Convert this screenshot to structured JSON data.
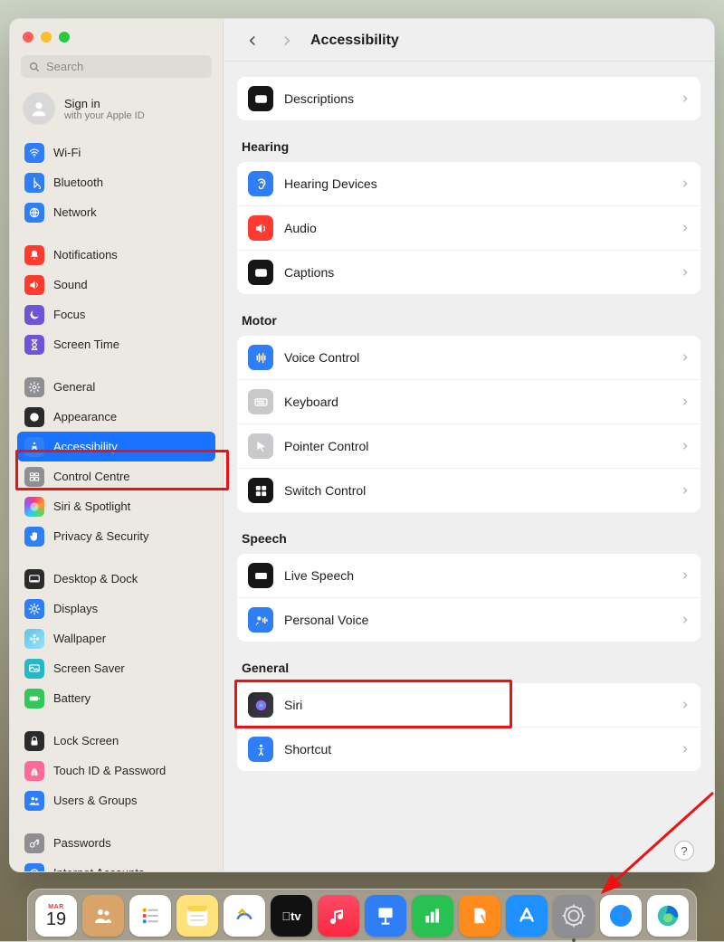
{
  "window": {
    "title": "Accessibility"
  },
  "search": {
    "placeholder": "Search"
  },
  "account": {
    "title": "Sign in",
    "subtitle": "with your Apple ID"
  },
  "sidebar": {
    "items": [
      {
        "label": "Wi-Fi",
        "iconClass": "bg-blue",
        "glyph": "wifi"
      },
      {
        "label": "Bluetooth",
        "iconClass": "bg-blue",
        "glyph": "bt"
      },
      {
        "label": "Network",
        "iconClass": "bg-blue",
        "glyph": "globe"
      },
      {
        "label": "Notifications",
        "iconClass": "bg-red",
        "glyph": "bell"
      },
      {
        "label": "Sound",
        "iconClass": "bg-red",
        "glyph": "speaker"
      },
      {
        "label": "Focus",
        "iconClass": "bg-purple",
        "glyph": "moon"
      },
      {
        "label": "Screen Time",
        "iconClass": "bg-purple",
        "glyph": "hourglass"
      },
      {
        "label": "General",
        "iconClass": "bg-gray",
        "glyph": "gear"
      },
      {
        "label": "Appearance",
        "iconClass": "bg-dark",
        "glyph": "appearance"
      },
      {
        "label": "Accessibility",
        "iconClass": "bg-blue",
        "glyph": "access",
        "selected": true
      },
      {
        "label": "Control Centre",
        "iconClass": "bg-gray",
        "glyph": "cc"
      },
      {
        "label": "Siri & Spotlight",
        "iconClass": "bg-spot",
        "glyph": "siri"
      },
      {
        "label": "Privacy & Security",
        "iconClass": "bg-blue",
        "glyph": "hand"
      },
      {
        "label": "Desktop & Dock",
        "iconClass": "bg-dark",
        "glyph": "dock"
      },
      {
        "label": "Displays",
        "iconClass": "bg-blue",
        "glyph": "sun"
      },
      {
        "label": "Wallpaper",
        "iconClass": "bg-wall",
        "glyph": "flower"
      },
      {
        "label": "Screen Saver",
        "iconClass": "bg-teal",
        "glyph": "ssaver"
      },
      {
        "label": "Battery",
        "iconClass": "bg-green",
        "glyph": "battery"
      },
      {
        "label": "Lock Screen",
        "iconClass": "bg-dark",
        "glyph": "lock"
      },
      {
        "label": "Touch ID & Password",
        "iconClass": "bg-pink",
        "glyph": "finger"
      },
      {
        "label": "Users & Groups",
        "iconClass": "bg-blue",
        "glyph": "users"
      },
      {
        "label": "Passwords",
        "iconClass": "bg-gray",
        "glyph": "key"
      },
      {
        "label": "Internet Accounts",
        "iconClass": "bg-blue",
        "glyph": "at"
      }
    ],
    "gaps": [
      3,
      7,
      13,
      18,
      21
    ]
  },
  "content": {
    "topRow": {
      "label": "Descriptions",
      "iconClass": "bg-black",
      "glyph": "desc"
    },
    "sections": [
      {
        "title": "Hearing",
        "rows": [
          {
            "label": "Hearing Devices",
            "iconClass": "bg-blue",
            "glyph": "ear"
          },
          {
            "label": "Audio",
            "iconClass": "bg-red",
            "glyph": "speaker"
          },
          {
            "label": "Captions",
            "iconClass": "bg-black",
            "glyph": "captions"
          }
        ]
      },
      {
        "title": "Motor",
        "rows": [
          {
            "label": "Voice Control",
            "iconClass": "bg-blue",
            "glyph": "voice"
          },
          {
            "label": "Keyboard",
            "iconClass": "bg-grayl",
            "glyph": "keyboard"
          },
          {
            "label": "Pointer Control",
            "iconClass": "bg-grayl",
            "glyph": "pointer"
          },
          {
            "label": "Switch Control",
            "iconClass": "bg-black",
            "glyph": "switch"
          }
        ]
      },
      {
        "title": "Speech",
        "rows": [
          {
            "label": "Live Speech",
            "iconClass": "bg-black",
            "glyph": "livespeech"
          },
          {
            "label": "Personal Voice",
            "iconClass": "bg-blue",
            "glyph": "pvoice"
          }
        ]
      },
      {
        "title": "General",
        "rows": [
          {
            "label": "Siri",
            "iconClass": "bg-grad-siri",
            "glyph": "siriorb",
            "highlight": true
          },
          {
            "label": "Shortcut",
            "iconClass": "bg-blue",
            "glyph": "shortcut"
          }
        ]
      }
    ]
  },
  "help": {
    "label": "?"
  },
  "dock": {
    "items": [
      {
        "name": "calendar",
        "bg": "#fff",
        "text": "19",
        "top": "MAR",
        "running": false
      },
      {
        "name": "contacts",
        "bg": "#d8a46a",
        "running": false
      },
      {
        "name": "reminders",
        "bg": "#fff",
        "running": false
      },
      {
        "name": "notes",
        "bg": "#ffe37a",
        "running": false
      },
      {
        "name": "freeform",
        "bg": "#fff",
        "running": false
      },
      {
        "name": "tv",
        "bg": "#111",
        "running": false
      },
      {
        "name": "music",
        "bg": "linear-gradient(#fb4b63,#fc2742)",
        "running": false
      },
      {
        "name": "keynote",
        "bg": "#2f7ef6",
        "running": false
      },
      {
        "name": "numbers",
        "bg": "#29c152",
        "running": false
      },
      {
        "name": "pages",
        "bg": "#ff8b1d",
        "running": false
      },
      {
        "name": "appstore",
        "bg": "#1e90ff",
        "running": false
      },
      {
        "name": "settings",
        "bg": "#8e8e93",
        "running": true
      },
      {
        "name": "safari",
        "bg": "#fff",
        "running": false
      },
      {
        "name": "edge",
        "bg": "#fff",
        "running": false
      }
    ]
  }
}
